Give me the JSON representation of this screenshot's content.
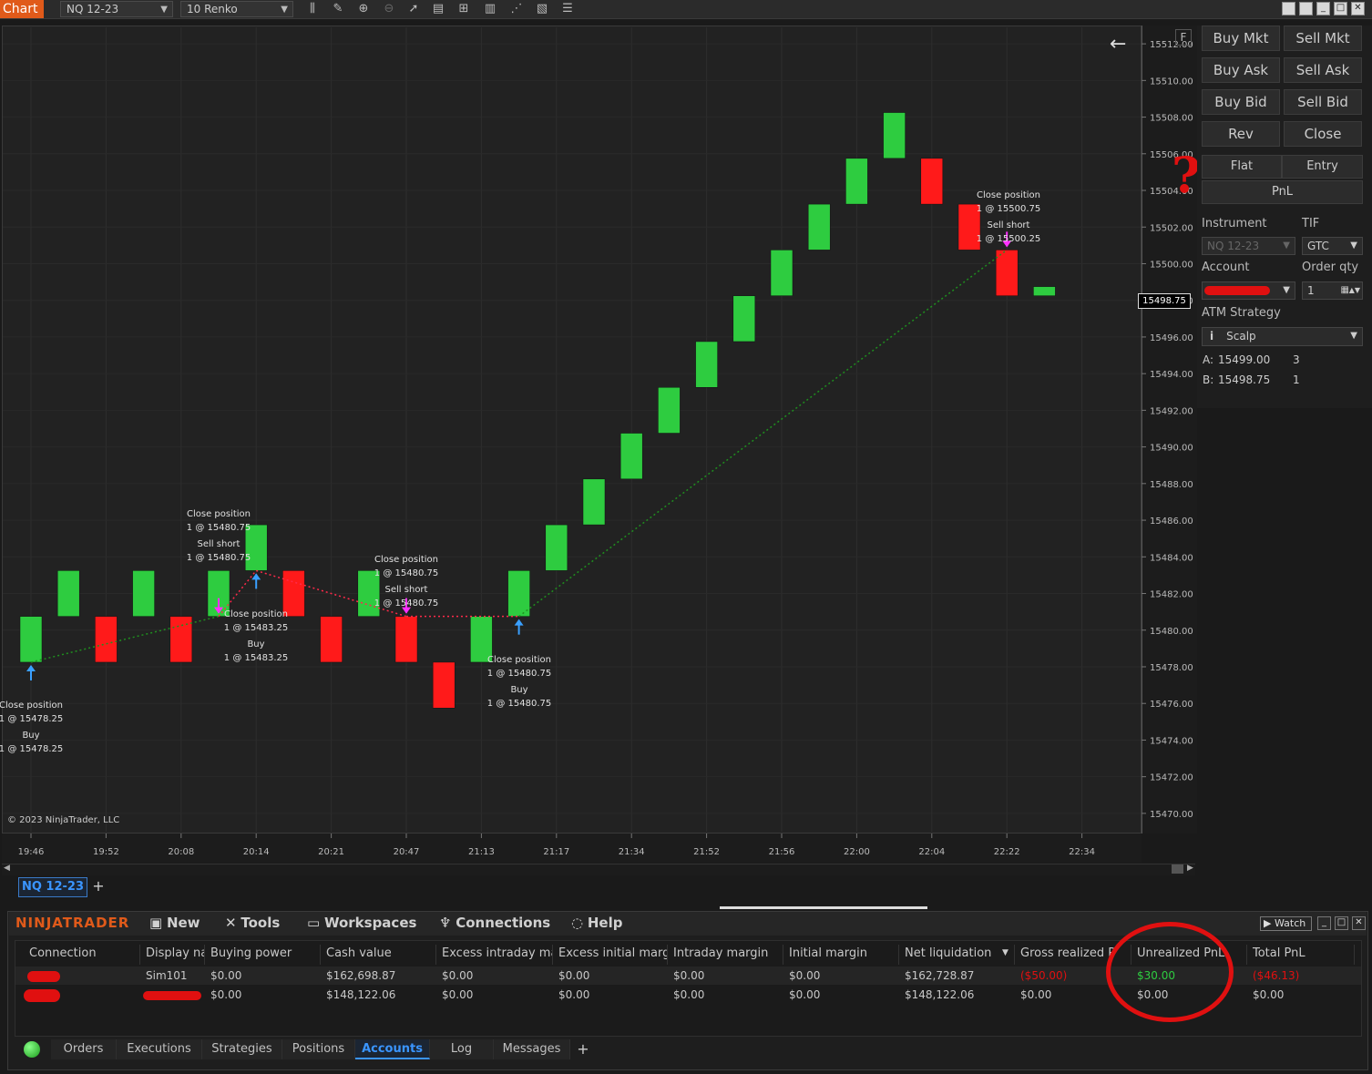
{
  "toolbar": {
    "chart_label": "Chart",
    "instrument": "NQ 12-23",
    "bar_type": "10 Renko"
  },
  "chart": {
    "copyright": "© 2023 NinjaTrader, LLC",
    "current_price": "15498.75",
    "f_label": "F",
    "annotations": [
      {
        "lines": [
          "Close position",
          "1 @ 15478.25",
          "Buy",
          "1 @ 15478.25"
        ]
      },
      {
        "lines": [
          "Close position",
          "1 @ 15480.75",
          "Sell short",
          "1 @ 15480.75"
        ]
      },
      {
        "lines": [
          "Close position",
          "1 @ 15483.25",
          "Buy",
          "1 @ 15483.25"
        ]
      },
      {
        "lines": [
          "Close position",
          "1 @ 15480.75",
          "Sell short",
          "1 @ 15480.75"
        ]
      },
      {
        "lines": [
          "Close position",
          "1 @ 15480.75",
          "Buy",
          "1 @ 15480.75"
        ]
      },
      {
        "lines": [
          "Close position",
          "1 @ 15500.75",
          "Sell short",
          "1 @ 15500.25"
        ]
      }
    ]
  },
  "chart_data": {
    "type": "bar",
    "subtype": "renko",
    "title": "",
    "ylim": [
      15469,
      15513
    ],
    "y_ticks": [
      "15512.00",
      "15510.00",
      "15508.00",
      "15506.00",
      "15504.00",
      "15502.00",
      "15500.00",
      "15498.00",
      "15496.00",
      "15494.00",
      "15492.00",
      "15490.00",
      "15488.00",
      "15486.00",
      "15484.00",
      "15482.00",
      "15480.00",
      "15478.00",
      "15476.00",
      "15474.00",
      "15472.00",
      "15470.00"
    ],
    "x_ticks": [
      "19:46",
      "19:52",
      "20:08",
      "20:14",
      "20:21",
      "20:47",
      "21:13",
      "21:17",
      "21:34",
      "21:52",
      "21:56",
      "22:00",
      "22:04",
      "22:22",
      "22:34"
    ],
    "bricks": [
      {
        "dir": "up",
        "low": 15478.25,
        "high": 15480.75
      },
      {
        "dir": "up",
        "low": 15480.75,
        "high": 15483.25
      },
      {
        "dir": "down",
        "low": 15478.25,
        "high": 15480.75
      },
      {
        "dir": "up",
        "low": 15480.75,
        "high": 15483.25
      },
      {
        "dir": "down",
        "low": 15478.25,
        "high": 15480.75
      },
      {
        "dir": "up",
        "low": 15480.75,
        "high": 15483.25
      },
      {
        "dir": "up",
        "low": 15483.25,
        "high": 15485.75
      },
      {
        "dir": "down",
        "low": 15480.75,
        "high": 15483.25
      },
      {
        "dir": "down",
        "low": 15478.25,
        "high": 15480.75
      },
      {
        "dir": "up",
        "low": 15480.75,
        "high": 15483.25
      },
      {
        "dir": "down",
        "low": 15478.25,
        "high": 15480.75
      },
      {
        "dir": "down",
        "low": 15475.75,
        "high": 15478.25
      },
      {
        "dir": "up",
        "low": 15478.25,
        "high": 15480.75
      },
      {
        "dir": "up",
        "low": 15480.75,
        "high": 15483.25
      },
      {
        "dir": "up",
        "low": 15483.25,
        "high": 15485.75
      },
      {
        "dir": "up",
        "low": 15485.75,
        "high": 15488.25
      },
      {
        "dir": "up",
        "low": 15488.25,
        "high": 15490.75
      },
      {
        "dir": "up",
        "low": 15490.75,
        "high": 15493.25
      },
      {
        "dir": "up",
        "low": 15493.25,
        "high": 15495.75
      },
      {
        "dir": "up",
        "low": 15495.75,
        "high": 15498.25
      },
      {
        "dir": "up",
        "low": 15498.25,
        "high": 15500.75
      },
      {
        "dir": "up",
        "low": 15500.75,
        "high": 15503.25
      },
      {
        "dir": "up",
        "low": 15503.25,
        "high": 15505.75
      },
      {
        "dir": "up",
        "low": 15505.75,
        "high": 15508.25
      },
      {
        "dir": "down",
        "low": 15503.25,
        "high": 15505.75
      },
      {
        "dir": "down",
        "low": 15500.75,
        "high": 15503.25
      },
      {
        "dir": "down",
        "low": 15498.25,
        "high": 15500.75
      },
      {
        "dir": "up",
        "low": 15498.25,
        "high": 15498.75
      }
    ],
    "colors": {
      "up": "#2ecc40",
      "down": "#ff1a1a",
      "long_trade_line": "#1f8f1f",
      "short_trade_line": "#ff2a4a",
      "buy_arrow": "#3aa0ff",
      "sell_arrow": "#ff30ff"
    }
  },
  "order_panel": {
    "buy_mkt": "Buy Mkt",
    "sell_mkt": "Sell Mkt",
    "buy_ask": "Buy Ask",
    "sell_ask": "Sell Ask",
    "buy_bid": "Buy Bid",
    "sell_bid": "Sell Bid",
    "rev": "Rev",
    "close": "Close",
    "flat": "Flat",
    "entry": "Entry",
    "pnl": "PnL",
    "instrument_label": "Instrument",
    "tif_label": "TIF",
    "instrument_value": "NQ 12-23",
    "tif_value": "GTC",
    "account_label": "Account",
    "order_qty_label": "Order qty",
    "order_qty_value": "1",
    "atm_label": "ATM Strategy",
    "atm_value": "Scalp",
    "ask_label": "A:",
    "ask_price": "15499.00",
    "ask_size": "3",
    "bid_label": "B:",
    "bid_price": "15498.75",
    "bid_size": "1"
  },
  "chart_tabs": {
    "active": "NQ 12-23",
    "add": "+"
  },
  "control_center": {
    "logo": "NINJATRADER",
    "menu": [
      "New",
      "Tools",
      "Workspaces",
      "Connections",
      "Help"
    ],
    "watch": "Watch",
    "columns": [
      "Connection",
      "Display na",
      "Buying power",
      "Cash value",
      "Excess intraday ma",
      "Excess initial margi",
      "Intraday margin",
      "Initial margin",
      "Net liquidation",
      "Gross realized P",
      "Unrealized PnL",
      "Total PnL"
    ],
    "rows": [
      {
        "connection": "",
        "display": "Sim101",
        "buying_power": "$0.00",
        "cash": "$162,698.87",
        "excess_intraday": "$0.00",
        "excess_initial": "$0.00",
        "intraday_margin": "$0.00",
        "initial_margin": "$0.00",
        "net_liq": "$162,728.87",
        "gross_realized": "($50.00)",
        "unrealized": "$30.00",
        "total": "($46.13)"
      },
      {
        "connection": "",
        "display": "",
        "buying_power": "$0.00",
        "cash": "$148,122.06",
        "excess_intraday": "$0.00",
        "excess_initial": "$0.00",
        "intraday_margin": "$0.00",
        "initial_margin": "$0.00",
        "net_liq": "$148,122.06",
        "gross_realized": "$0.00",
        "unrealized": "$0.00",
        "total": "$0.00"
      }
    ],
    "tabs": [
      "Orders",
      "Executions",
      "Strategies",
      "Positions",
      "Accounts",
      "Log",
      "Messages"
    ],
    "active_tab": "Accounts",
    "add_tab": "+"
  }
}
